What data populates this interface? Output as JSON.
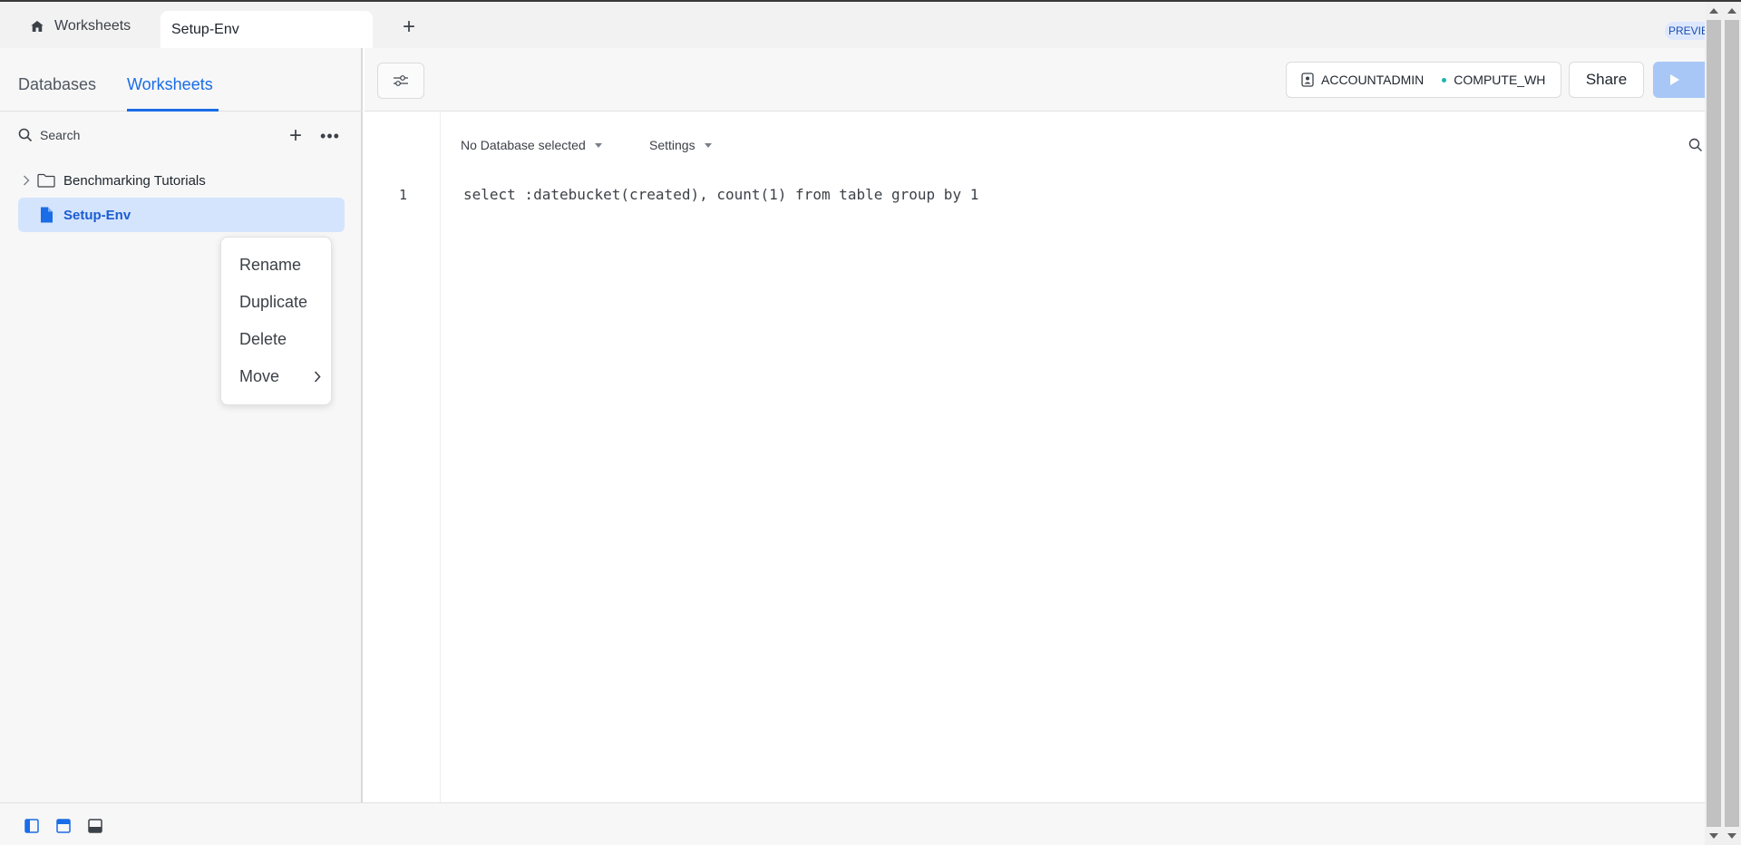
{
  "tabs": {
    "home_label": "Worksheets",
    "active_label": "Setup-Env",
    "add_symbol": "+",
    "preview_badge": "PREVIEW"
  },
  "left_panel": {
    "tab_databases": "Databases",
    "tab_worksheets": "Worksheets",
    "search_label": "Search",
    "add_symbol": "+",
    "more_symbol": "•••",
    "tree": [
      {
        "label": "Benchmarking Tutorials",
        "type": "folder"
      },
      {
        "label": "Setup-Env",
        "type": "worksheet",
        "selected": true
      }
    ]
  },
  "context_menu": {
    "items": [
      "Rename",
      "Duplicate",
      "Delete",
      "Move"
    ]
  },
  "editor_header": {
    "role": "ACCOUNTADMIN",
    "warehouse": "COMPUTE_WH",
    "share_label": "Share"
  },
  "editor": {
    "database_selector": "No Database selected",
    "settings_label": "Settings",
    "line_number": "1",
    "code": "select :datebucket(created), count(1) from table group by 1"
  },
  "colors": {
    "accent": "#1a6ce7",
    "selected_bg": "#d4e4fd",
    "run_button": "#a8c7f7",
    "warehouse_dot": "#1ab5b0"
  }
}
